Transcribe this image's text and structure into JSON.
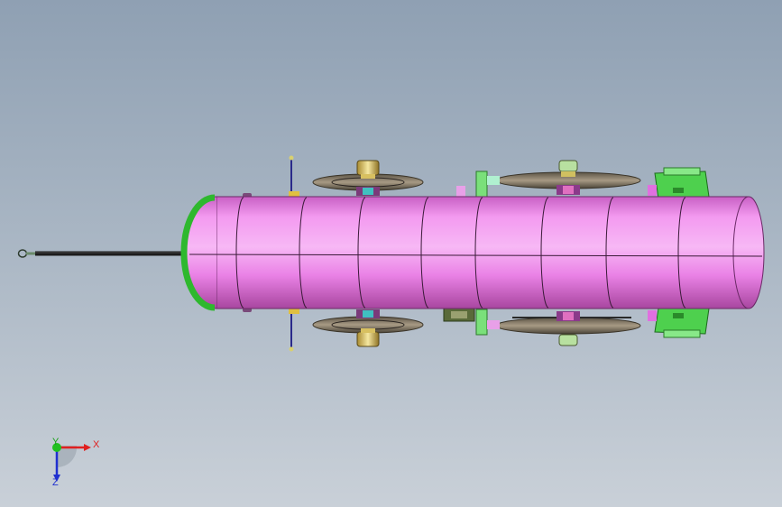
{
  "viewport": {
    "background_top": "#8fa0b3",
    "background_bottom": "#c9d0d8"
  },
  "model": {
    "tank_color": "#ee88ee",
    "tank_highlight": "#f6b4f4",
    "tank_shadow": "#b84fb4",
    "end_cap_color": "#3ccc3c",
    "bracket_color": "#6ad86a",
    "wheel_color": "#8a7a64",
    "axle_color": "#3a3aa0"
  },
  "triad": {
    "x_label": "X",
    "y_label": "Y",
    "z_label": "Z",
    "x_color": "#e02020",
    "y_color": "#20c020",
    "z_color": "#2030d0"
  }
}
